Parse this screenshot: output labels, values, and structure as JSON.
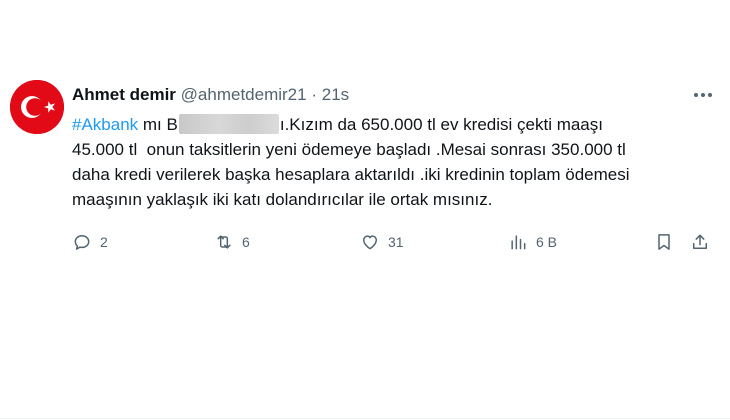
{
  "author": {
    "display_name": "Ahmet demir",
    "handle": "@ahmetdemir21",
    "separator": "·",
    "time": "21s",
    "avatar_icon": "turkish-flag-avatar"
  },
  "tweet": {
    "line1_hashtag": "#Akbank",
    "line1_prefix": " mı B",
    "line1_suffix": "ı.Kızım da 650.000 tl ev kredisi çekti maaşı",
    "line2": "45.000 tl  onun taksitlerin yeni ödemeye başladı .Mesai sonrası 350.000 tl",
    "line3": "daha kredi verilerek başka hesaplara aktarıldı .iki kredinin toplam ödemesi",
    "line4": "maaşının yaklaşık iki katı dolandırıcılar ile ortak mısınız."
  },
  "actions": {
    "replies": "2",
    "retweets": "6",
    "likes": "31",
    "views": "6 B"
  },
  "colors": {
    "accent": "#1d9bf0",
    "muted": "#536471",
    "text": "#0f1419",
    "flag_red": "#e30a17"
  }
}
